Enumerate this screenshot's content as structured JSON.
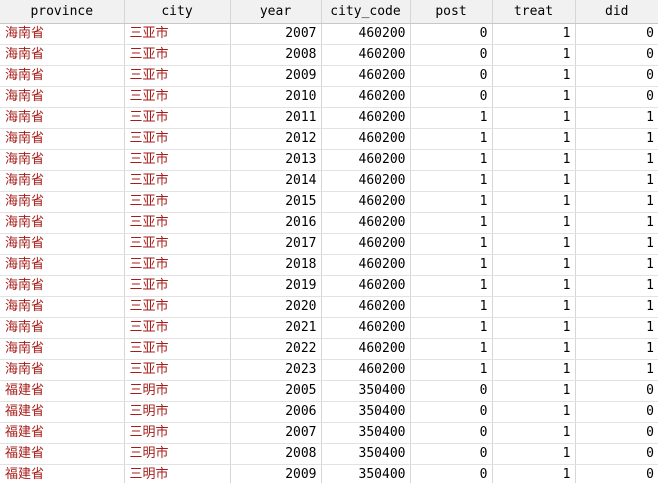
{
  "columns": [
    "province",
    "city",
    "year",
    "city_code",
    "post",
    "treat",
    "did"
  ],
  "rows": [
    [
      "海南省",
      "三亚市",
      "2007",
      "460200",
      "0",
      "1",
      "0"
    ],
    [
      "海南省",
      "三亚市",
      "2008",
      "460200",
      "0",
      "1",
      "0"
    ],
    [
      "海南省",
      "三亚市",
      "2009",
      "460200",
      "0",
      "1",
      "0"
    ],
    [
      "海南省",
      "三亚市",
      "2010",
      "460200",
      "0",
      "1",
      "0"
    ],
    [
      "海南省",
      "三亚市",
      "2011",
      "460200",
      "1",
      "1",
      "1"
    ],
    [
      "海南省",
      "三亚市",
      "2012",
      "460200",
      "1",
      "1",
      "1"
    ],
    [
      "海南省",
      "三亚市",
      "2013",
      "460200",
      "1",
      "1",
      "1"
    ],
    [
      "海南省",
      "三亚市",
      "2014",
      "460200",
      "1",
      "1",
      "1"
    ],
    [
      "海南省",
      "三亚市",
      "2015",
      "460200",
      "1",
      "1",
      "1"
    ],
    [
      "海南省",
      "三亚市",
      "2016",
      "460200",
      "1",
      "1",
      "1"
    ],
    [
      "海南省",
      "三亚市",
      "2017",
      "460200",
      "1",
      "1",
      "1"
    ],
    [
      "海南省",
      "三亚市",
      "2018",
      "460200",
      "1",
      "1",
      "1"
    ],
    [
      "海南省",
      "三亚市",
      "2019",
      "460200",
      "1",
      "1",
      "1"
    ],
    [
      "海南省",
      "三亚市",
      "2020",
      "460200",
      "1",
      "1",
      "1"
    ],
    [
      "海南省",
      "三亚市",
      "2021",
      "460200",
      "1",
      "1",
      "1"
    ],
    [
      "海南省",
      "三亚市",
      "2022",
      "460200",
      "1",
      "1",
      "1"
    ],
    [
      "海南省",
      "三亚市",
      "2023",
      "460200",
      "1",
      "1",
      "1"
    ],
    [
      "福建省",
      "三明市",
      "2005",
      "350400",
      "0",
      "1",
      "0"
    ],
    [
      "福建省",
      "三明市",
      "2006",
      "350400",
      "0",
      "1",
      "0"
    ],
    [
      "福建省",
      "三明市",
      "2007",
      "350400",
      "0",
      "1",
      "0"
    ],
    [
      "福建省",
      "三明市",
      "2008",
      "350400",
      "0",
      "1",
      "0"
    ],
    [
      "福建省",
      "三明市",
      "2009",
      "350400",
      "0",
      "1",
      "0"
    ]
  ],
  "colors": {
    "string_cell": "#a51c18",
    "numeric_cell": "#000000",
    "header_bg": "#f1f1f1",
    "grid_line": "#d6d6d6"
  }
}
